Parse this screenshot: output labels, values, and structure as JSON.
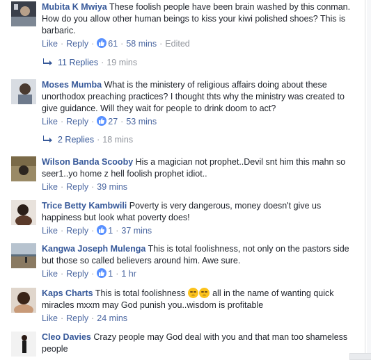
{
  "comments": [
    {
      "author": "Mubita K Mwiya",
      "text": "These foolish people have been brain washed by this conman. How do you allow other human beings to kiss your kiwi polished shoes? This is barbaric.",
      "like": "Like",
      "reply": "Reply",
      "reactions": "61",
      "time": "58 mins",
      "edited": "Edited",
      "replies_label": "11 Replies",
      "replies_time": "19 mins"
    },
    {
      "author": "Moses Mumba",
      "text": "What is the ministery of religious affairs doing about these unorthodox preaching practices? I thought thts why the ministry was created to give guidance. Will they wait for people to drink doom to act?",
      "like": "Like",
      "reply": "Reply",
      "reactions": "27",
      "time": "53 mins",
      "replies_label": "2 Replies",
      "replies_time": "18 mins"
    },
    {
      "author": "Wilson Banda Scooby",
      "text": "His a magician not prophet..Devil snt him this mahn so seer1..yo home z hell foolish prophet idiot..",
      "like": "Like",
      "reply": "Reply",
      "time": "39 mins"
    },
    {
      "author": "Trice Betty Kambwili",
      "text": "Poverty is very dangerous, money doesn't give us happiness but look what poverty does!",
      "like": "Like",
      "reply": "Reply",
      "reactions": "1",
      "time": "37 mins"
    },
    {
      "author": "Kangwa Joseph Mulenga",
      "text": "This is total foolishness, not only on the pastors side but those so called believers around him. Awe sure.",
      "like": "Like",
      "reply": "Reply",
      "reactions": "1",
      "time": "1 hr"
    },
    {
      "author": "Kaps Charts",
      "text_before": "This is total foolishness",
      "text_after": "all in the name of wanting quick miracles mxxm may God punish you..wisdom is profitable",
      "emoji": "disappointed-face-emoji",
      "like": "Like",
      "reply": "Reply",
      "time": "24 mins"
    },
    {
      "author": "Cleo Davies",
      "text": "Crazy people may God deal with you and that man too shameless people"
    }
  ],
  "colors": {
    "author": "#365899",
    "meta": "#90949c",
    "link": "#4b67a1",
    "like_badge": "#5890ff"
  }
}
